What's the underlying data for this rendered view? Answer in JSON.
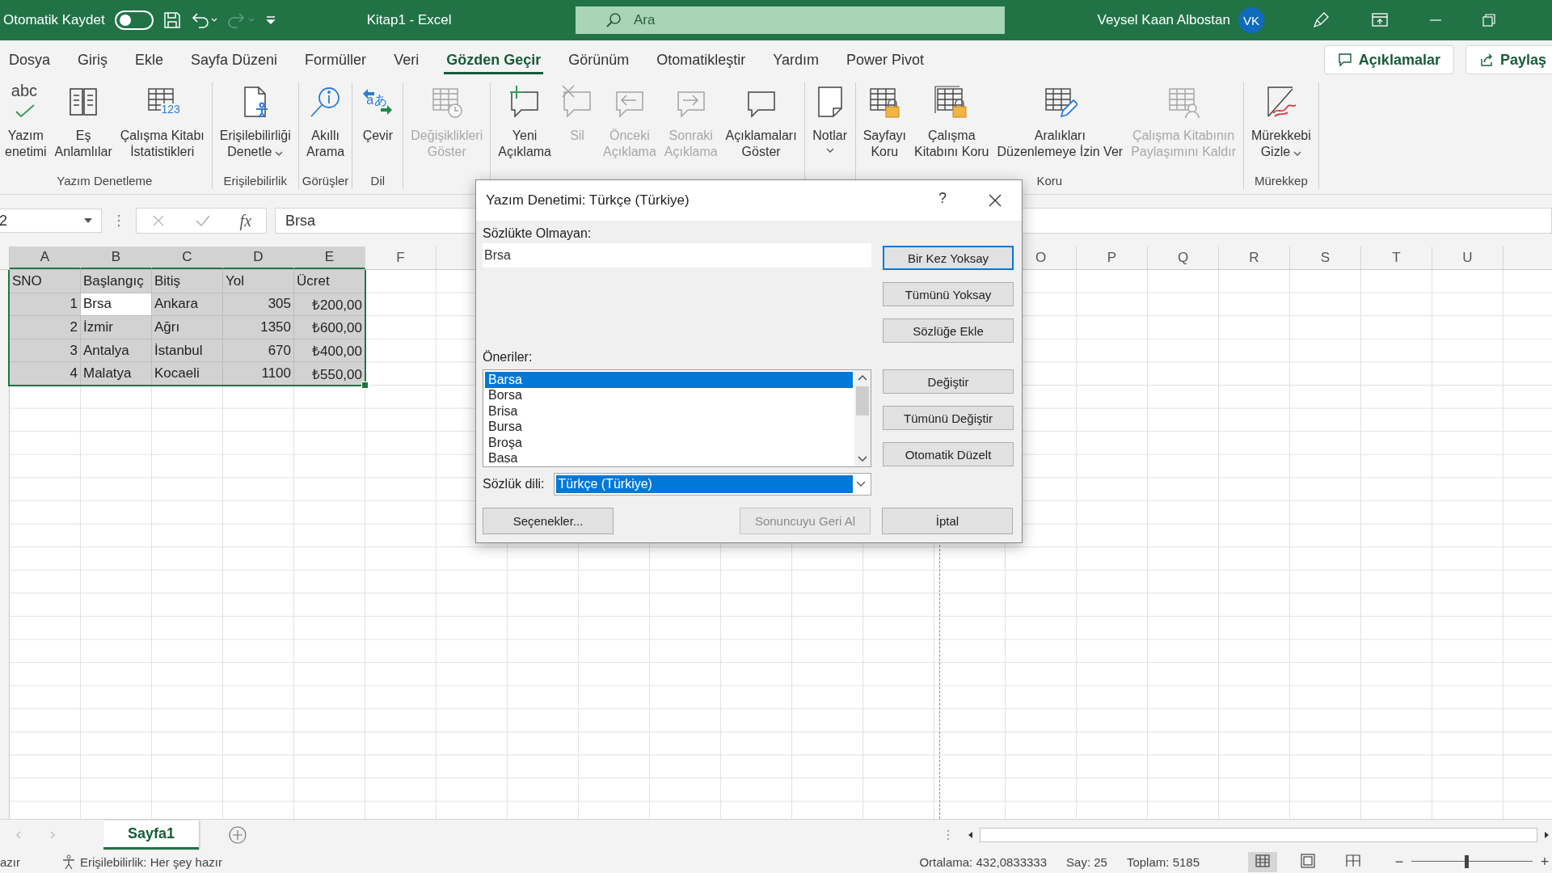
{
  "title_bar": {
    "autosave_label": "Otomatik Kaydet",
    "autosave_on": false,
    "document_title": "Kitap1  -  Excel",
    "search_placeholder": "Ara",
    "user_name": "Veysel Kaan Albostan",
    "avatar_initials": "VK"
  },
  "ribbon_tabs": [
    {
      "label": "Dosya",
      "selected": false
    },
    {
      "label": "Giriş",
      "selected": false
    },
    {
      "label": "Ekle",
      "selected": false
    },
    {
      "label": "Sayfa Düzeni",
      "selected": false
    },
    {
      "label": "Formüller",
      "selected": false
    },
    {
      "label": "Veri",
      "selected": false
    },
    {
      "label": "Gözden Geçir",
      "selected": true
    },
    {
      "label": "Görünüm",
      "selected": false
    },
    {
      "label": "Otomatikleştir",
      "selected": false
    },
    {
      "label": "Yardım",
      "selected": false
    },
    {
      "label": "Power Pivot",
      "selected": false
    }
  ],
  "ribbon_actions": [
    {
      "label": "Açıklamalar",
      "kind": "comments"
    },
    {
      "label": "Paylaş",
      "kind": "share"
    }
  ],
  "ribbon_groups": [
    {
      "label": "Yazım Denetleme",
      "buttons": [
        {
          "lines": [
            "Yazım",
            "enetimi"
          ],
          "kind": "spelling",
          "glyph": "abc",
          "disabled": false
        },
        {
          "lines": [
            "Eş",
            "Anlamlılar"
          ],
          "kind": "book",
          "disabled": false
        },
        {
          "lines": [
            "Çalışma Kitabı",
            "İstatistikleri"
          ],
          "kind": "stats",
          "glyph": "123",
          "disabled": false
        }
      ]
    },
    {
      "label": "Erişilebilirlik",
      "buttons": [
        {
          "lines": [
            "Erişilebilirliği",
            "Denetle"
          ],
          "kind": "access",
          "dropdown": true,
          "disabled": false
        }
      ]
    },
    {
      "label": "Görüşler",
      "buttons": [
        {
          "lines": [
            "Akıllı",
            "Arama"
          ],
          "kind": "lookup",
          "disabled": false
        }
      ]
    },
    {
      "label": "Dil",
      "buttons": [
        {
          "lines": [
            "Çevir"
          ],
          "kind": "translate",
          "glyph": "aあ",
          "disabled": false
        }
      ]
    },
    {
      "buttons": [
        {
          "lines": [
            "Değişiklikleri",
            "Göster"
          ],
          "kind": "changes",
          "disabled": true
        }
      ]
    },
    {
      "buttons": [
        {
          "lines": [
            "Yeni",
            "Açıklama"
          ],
          "kind": "comment-new",
          "disabled": false
        },
        {
          "lines": [
            "Sil"
          ],
          "kind": "comment-delete",
          "disabled": true
        },
        {
          "lines": [
            "Önceki",
            "Açıklama"
          ],
          "kind": "comment-prev",
          "disabled": true
        },
        {
          "lines": [
            "Sonraki",
            "Açıklama"
          ],
          "kind": "comment-next",
          "disabled": true
        },
        {
          "lines": [
            "Açıklamaları",
            "Göster"
          ],
          "kind": "comment",
          "disabled": false
        }
      ]
    },
    {
      "buttons": [
        {
          "lines": [
            "Notlar"
          ],
          "kind": "note",
          "dropdown": true,
          "disabled": false
        }
      ]
    },
    {
      "label": "Koru",
      "buttons": [
        {
          "lines": [
            "Sayfayı",
            "Koru"
          ],
          "kind": "protect-sheet",
          "disabled": false
        },
        {
          "lines": [
            "Çalışma",
            "Kitabını Koru"
          ],
          "kind": "protect-book",
          "disabled": false
        },
        {
          "lines": [
            "Aralıkları",
            "Düzenlemeye İzin Ver"
          ],
          "kind": "allow-edit",
          "disabled": false
        },
        {
          "lines": [
            "Çalışma Kitabının",
            "Paylaşımını Kaldır"
          ],
          "kind": "unshare",
          "disabled": true
        }
      ]
    },
    {
      "label": "Mürekkep",
      "buttons": [
        {
          "lines": [
            "Mürekkebi",
            "Gizle"
          ],
          "kind": "ink",
          "dropdown": true,
          "disabled": false
        }
      ]
    }
  ],
  "formula_bar": {
    "name_box": "2",
    "function_symbol": "fx",
    "value": "Brsa"
  },
  "sheet": {
    "columns": [
      {
        "label": "A",
        "selected": true
      },
      {
        "label": "B",
        "selected": true
      },
      {
        "label": "C",
        "selected": true
      },
      {
        "label": "D",
        "selected": true
      },
      {
        "label": "E",
        "selected": true
      },
      {
        "label": "F",
        "selected": false
      }
    ],
    "right_columns": [
      {
        "label": "O",
        "selected": false
      },
      {
        "label": "P",
        "selected": false
      },
      {
        "label": "Q",
        "selected": false
      },
      {
        "label": "R",
        "selected": false
      },
      {
        "label": "S",
        "selected": false
      },
      {
        "label": "T",
        "selected": false
      },
      {
        "label": "U",
        "selected": false
      }
    ],
    "rows": [
      {
        "cells": [
          {
            "text": "SNO",
            "kind": "text",
            "selected": false
          },
          {
            "text": "Başlangıç",
            "kind": "text",
            "selected": false
          },
          {
            "text": "Bitiş",
            "kind": "text",
            "selected": false
          },
          {
            "text": "Yol",
            "kind": "text",
            "selected": false
          },
          {
            "text": "Ücret",
            "kind": "text",
            "selected": false
          }
        ]
      },
      {
        "cells": [
          {
            "text": "1",
            "kind": "number",
            "selected": false
          },
          {
            "text": "Brsa",
            "kind": "text",
            "selected": true
          },
          {
            "text": "Ankara",
            "kind": "text",
            "selected": false
          },
          {
            "text": "305",
            "kind": "number",
            "selected": false
          },
          {
            "text": "₺200,00",
            "kind": "number",
            "selected": false
          }
        ]
      },
      {
        "cells": [
          {
            "text": "2",
            "kind": "number",
            "selected": false
          },
          {
            "text": "İzmir",
            "kind": "text",
            "selected": false
          },
          {
            "text": "Ağrı",
            "kind": "text",
            "selected": false
          },
          {
            "text": "1350",
            "kind": "number",
            "selected": false
          },
          {
            "text": "₺600,00",
            "kind": "number",
            "selected": false
          }
        ]
      },
      {
        "cells": [
          {
            "text": "3",
            "kind": "number",
            "selected": false
          },
          {
            "text": "Antalya",
            "kind": "text",
            "selected": false
          },
          {
            "text": "İstanbul",
            "kind": "text",
            "selected": false
          },
          {
            "text": "670",
            "kind": "number",
            "selected": false
          },
          {
            "text": "₺400,00",
            "kind": "number",
            "selected": false
          }
        ]
      },
      {
        "cells": [
          {
            "text": "4",
            "kind": "number",
            "selected": false
          },
          {
            "text": "Malatya",
            "kind": "text",
            "selected": false
          },
          {
            "text": "Kocaeli",
            "kind": "text",
            "selected": false
          },
          {
            "text": "1100",
            "kind": "number",
            "selected": false
          },
          {
            "text": "₺550,00",
            "kind": "number",
            "selected": false
          }
        ]
      }
    ]
  },
  "sheet_tabs": [
    {
      "label": "Sayfa1",
      "selected": true
    }
  ],
  "status_bar": {
    "mode": "azır",
    "accessibility": "Erişilebilirlik: Her şey hazır",
    "average": "Ortalama: 432,0833333",
    "count": "Say: 25",
    "sum": "Toplam: 5185",
    "views": [
      {
        "kind": "normal",
        "selected": true
      },
      {
        "kind": "page-layout",
        "selected": false
      },
      {
        "kind": "page-break",
        "selected": false
      }
    ],
    "zoom_out": "−",
    "zoom_in": "+",
    "zoom": {
      "level": 0.45
    }
  },
  "dialog": {
    "title": "Yazım Denetimi: Türkçe (Türkiye)",
    "help": "?",
    "not_in_dictionary_label": "Sözlükte Olmayan:",
    "word": "Brsa",
    "suggestions_label": "Öneriler:",
    "suggestions": [
      {
        "text": "Barsa",
        "selected": true
      },
      {
        "text": "Borsa",
        "selected": false
      },
      {
        "text": "Brisa",
        "selected": false
      },
      {
        "text": "Bursa",
        "selected": false
      },
      {
        "text": "Broşa",
        "selected": false
      },
      {
        "text": "Basa",
        "selected": false
      }
    ],
    "language_label": "Sözlük dili:",
    "language": "Türkçe (Türkiye)",
    "ignore_buttons": [
      {
        "label": "Bir Kez Yoksay",
        "default": true,
        "disabled": false
      },
      {
        "label": "Tümünü Yoksay",
        "default": false,
        "disabled": false
      },
      {
        "label": "Sözlüğe Ekle",
        "default": false,
        "disabled": false
      }
    ],
    "change_buttons": [
      {
        "label": "Değiştir",
        "default": false,
        "disabled": false
      },
      {
        "label": "Tümünü Değiştir",
        "default": false,
        "disabled": false
      },
      {
        "label": "Otomatik Düzelt",
        "default": false,
        "disabled": false
      }
    ],
    "bottom_buttons": [
      {
        "label": "Seçenekler...",
        "disabled": false
      },
      {
        "label": "Sonuncuyu Geri Al",
        "disabled": true
      },
      {
        "label": "İptal",
        "disabled": false
      }
    ]
  }
}
